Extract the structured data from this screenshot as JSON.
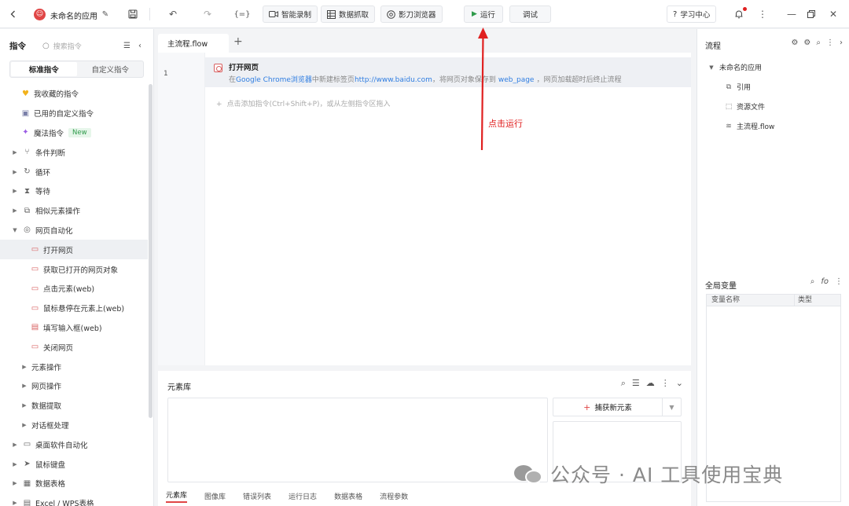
{
  "topbar": {
    "app_name": "未命名的应用",
    "smart_record": "智能录制",
    "data_capture": "数据抓取",
    "browser": "影刀浏览器",
    "run": "运行",
    "debug": "调试",
    "learning": "学习中心"
  },
  "left": {
    "title": "指令",
    "search_placeholder": "搜索指令",
    "tab_standard": "标准指令",
    "tab_custom": "自定义指令",
    "items": [
      {
        "label": "我收藏的指令",
        "icon": "heart-icon",
        "level": 0,
        "arrow": false
      },
      {
        "label": "已用的自定义指令",
        "icon": "box-icon",
        "level": 0,
        "arrow": false
      },
      {
        "label": "魔法指令",
        "icon": "sparkle-icon",
        "level": 0,
        "arrow": false,
        "badge": "New"
      },
      {
        "label": "条件判断",
        "icon": "branch-icon",
        "level": 0,
        "arrow": true
      },
      {
        "label": "循环",
        "icon": "loop-icon",
        "level": 0,
        "arrow": true
      },
      {
        "label": "等待",
        "icon": "hourglass-icon",
        "level": 0,
        "arrow": true
      },
      {
        "label": "相似元素操作",
        "icon": "copy-icon",
        "level": 0,
        "arrow": true
      },
      {
        "label": "网页自动化",
        "icon": "globe-icon",
        "level": 0,
        "arrow": true,
        "expanded": true
      },
      {
        "label": "打开网页",
        "icon": "webpage-icon",
        "level": 1,
        "arrow": false,
        "selected": true
      },
      {
        "label": "获取已打开的网页对象",
        "icon": "webpage-icon",
        "level": 1,
        "arrow": false
      },
      {
        "label": "点击元素(web)",
        "icon": "webpage-click-icon",
        "level": 1,
        "arrow": false
      },
      {
        "label": "鼠标悬停在元素上(web)",
        "icon": "webpage-hover-icon",
        "level": 1,
        "arrow": false
      },
      {
        "label": "填写输入框(web)",
        "icon": "input-icon",
        "level": 1,
        "arrow": false
      },
      {
        "label": "关闭网页",
        "icon": "webpage-close-icon",
        "level": 1,
        "arrow": false
      },
      {
        "label": "元素操作",
        "icon": "",
        "level": 1,
        "arrow": true
      },
      {
        "label": "网页操作",
        "icon": "",
        "level": 1,
        "arrow": true
      },
      {
        "label": "数据提取",
        "icon": "",
        "level": 1,
        "arrow": true
      },
      {
        "label": "对话框处理",
        "icon": "",
        "level": 1,
        "arrow": true
      },
      {
        "label": "桌面软件自动化",
        "icon": "desktop-icon",
        "level": 0,
        "arrow": true
      },
      {
        "label": "鼠标键盘",
        "icon": "cursor-icon",
        "level": 0,
        "arrow": true
      },
      {
        "label": "数据表格",
        "icon": "table-icon",
        "level": 0,
        "arrow": true
      },
      {
        "label": "Excel / WPS表格",
        "icon": "excel-icon",
        "level": 0,
        "arrow": true
      }
    ]
  },
  "editor": {
    "tab": "主流程.flow",
    "line_number": "1",
    "cmd_title": "打开网页",
    "desc_1": "在",
    "desc_2": "Google Chrome浏览器",
    "desc_3": "中新建标签页",
    "desc_4": "http://www.baidu.com",
    "desc_5": "，将网页对象保存到",
    "desc_6": "web_page",
    "desc_7": "，网页加载超时后终止流程",
    "add_hint": "点击添加指令(Ctrl+Shift+P)，或从左侧指令区拖入"
  },
  "element_library": {
    "title": "元素库",
    "capture": "捕获新元素",
    "tabs": [
      "元素库",
      "图像库",
      "错误列表",
      "运行日志",
      "数据表格",
      "流程参数"
    ]
  },
  "right": {
    "flow_title": "流程",
    "app": "未命名的应用",
    "ref": "引用",
    "resources": "资源文件",
    "main_flow": "主流程.flow",
    "globals_title": "全局变量",
    "col_name": "变量名称",
    "col_type": "类型"
  },
  "annotation": {
    "text": "点击运行",
    "color": "#e02020"
  },
  "watermark": {
    "text": "公众号 · AI 工具使用宝典"
  }
}
